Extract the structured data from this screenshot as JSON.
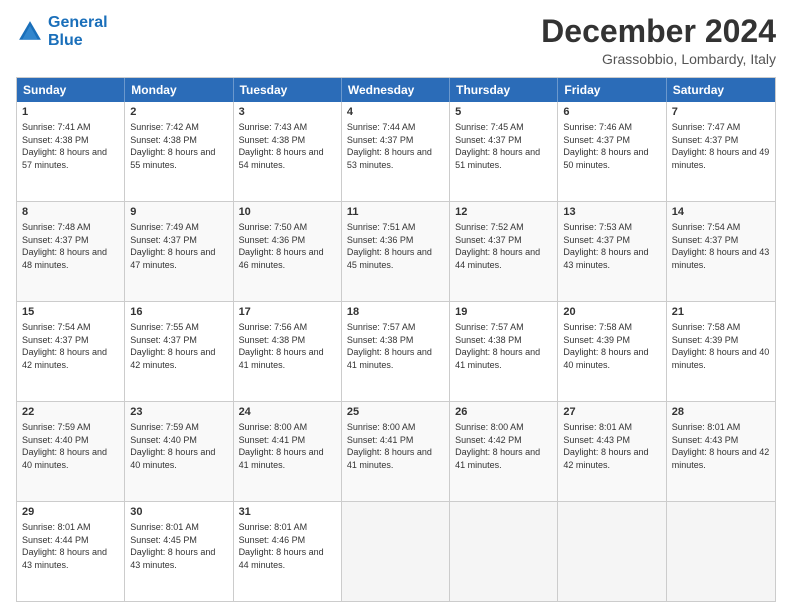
{
  "header": {
    "logo_line1": "General",
    "logo_line2": "Blue",
    "main_title": "December 2024",
    "sub_title": "Grassobbio, Lombardy, Italy"
  },
  "days_of_week": [
    "Sunday",
    "Monday",
    "Tuesday",
    "Wednesday",
    "Thursday",
    "Friday",
    "Saturday"
  ],
  "weeks": [
    [
      {
        "day": "1",
        "rise": "Sunrise: 7:41 AM",
        "set": "Sunset: 4:38 PM",
        "daylight": "Daylight: 8 hours and 57 minutes."
      },
      {
        "day": "2",
        "rise": "Sunrise: 7:42 AM",
        "set": "Sunset: 4:38 PM",
        "daylight": "Daylight: 8 hours and 55 minutes."
      },
      {
        "day": "3",
        "rise": "Sunrise: 7:43 AM",
        "set": "Sunset: 4:38 PM",
        "daylight": "Daylight: 8 hours and 54 minutes."
      },
      {
        "day": "4",
        "rise": "Sunrise: 7:44 AM",
        "set": "Sunset: 4:37 PM",
        "daylight": "Daylight: 8 hours and 53 minutes."
      },
      {
        "day": "5",
        "rise": "Sunrise: 7:45 AM",
        "set": "Sunset: 4:37 PM",
        "daylight": "Daylight: 8 hours and 51 minutes."
      },
      {
        "day": "6",
        "rise": "Sunrise: 7:46 AM",
        "set": "Sunset: 4:37 PM",
        "daylight": "Daylight: 8 hours and 50 minutes."
      },
      {
        "day": "7",
        "rise": "Sunrise: 7:47 AM",
        "set": "Sunset: 4:37 PM",
        "daylight": "Daylight: 8 hours and 49 minutes."
      }
    ],
    [
      {
        "day": "8",
        "rise": "Sunrise: 7:48 AM",
        "set": "Sunset: 4:37 PM",
        "daylight": "Daylight: 8 hours and 48 minutes."
      },
      {
        "day": "9",
        "rise": "Sunrise: 7:49 AM",
        "set": "Sunset: 4:37 PM",
        "daylight": "Daylight: 8 hours and 47 minutes."
      },
      {
        "day": "10",
        "rise": "Sunrise: 7:50 AM",
        "set": "Sunset: 4:36 PM",
        "daylight": "Daylight: 8 hours and 46 minutes."
      },
      {
        "day": "11",
        "rise": "Sunrise: 7:51 AM",
        "set": "Sunset: 4:36 PM",
        "daylight": "Daylight: 8 hours and 45 minutes."
      },
      {
        "day": "12",
        "rise": "Sunrise: 7:52 AM",
        "set": "Sunset: 4:37 PM",
        "daylight": "Daylight: 8 hours and 44 minutes."
      },
      {
        "day": "13",
        "rise": "Sunrise: 7:53 AM",
        "set": "Sunset: 4:37 PM",
        "daylight": "Daylight: 8 hours and 43 minutes."
      },
      {
        "day": "14",
        "rise": "Sunrise: 7:54 AM",
        "set": "Sunset: 4:37 PM",
        "daylight": "Daylight: 8 hours and 43 minutes."
      }
    ],
    [
      {
        "day": "15",
        "rise": "Sunrise: 7:54 AM",
        "set": "Sunset: 4:37 PM",
        "daylight": "Daylight: 8 hours and 42 minutes."
      },
      {
        "day": "16",
        "rise": "Sunrise: 7:55 AM",
        "set": "Sunset: 4:37 PM",
        "daylight": "Daylight: 8 hours and 42 minutes."
      },
      {
        "day": "17",
        "rise": "Sunrise: 7:56 AM",
        "set": "Sunset: 4:38 PM",
        "daylight": "Daylight: 8 hours and 41 minutes."
      },
      {
        "day": "18",
        "rise": "Sunrise: 7:57 AM",
        "set": "Sunset: 4:38 PM",
        "daylight": "Daylight: 8 hours and 41 minutes."
      },
      {
        "day": "19",
        "rise": "Sunrise: 7:57 AM",
        "set": "Sunset: 4:38 PM",
        "daylight": "Daylight: 8 hours and 41 minutes."
      },
      {
        "day": "20",
        "rise": "Sunrise: 7:58 AM",
        "set": "Sunset: 4:39 PM",
        "daylight": "Daylight: 8 hours and 40 minutes."
      },
      {
        "day": "21",
        "rise": "Sunrise: 7:58 AM",
        "set": "Sunset: 4:39 PM",
        "daylight": "Daylight: 8 hours and 40 minutes."
      }
    ],
    [
      {
        "day": "22",
        "rise": "Sunrise: 7:59 AM",
        "set": "Sunset: 4:40 PM",
        "daylight": "Daylight: 8 hours and 40 minutes."
      },
      {
        "day": "23",
        "rise": "Sunrise: 7:59 AM",
        "set": "Sunset: 4:40 PM",
        "daylight": "Daylight: 8 hours and 40 minutes."
      },
      {
        "day": "24",
        "rise": "Sunrise: 8:00 AM",
        "set": "Sunset: 4:41 PM",
        "daylight": "Daylight: 8 hours and 41 minutes."
      },
      {
        "day": "25",
        "rise": "Sunrise: 8:00 AM",
        "set": "Sunset: 4:41 PM",
        "daylight": "Daylight: 8 hours and 41 minutes."
      },
      {
        "day": "26",
        "rise": "Sunrise: 8:00 AM",
        "set": "Sunset: 4:42 PM",
        "daylight": "Daylight: 8 hours and 41 minutes."
      },
      {
        "day": "27",
        "rise": "Sunrise: 8:01 AM",
        "set": "Sunset: 4:43 PM",
        "daylight": "Daylight: 8 hours and 42 minutes."
      },
      {
        "day": "28",
        "rise": "Sunrise: 8:01 AM",
        "set": "Sunset: 4:43 PM",
        "daylight": "Daylight: 8 hours and 42 minutes."
      }
    ],
    [
      {
        "day": "29",
        "rise": "Sunrise: 8:01 AM",
        "set": "Sunset: 4:44 PM",
        "daylight": "Daylight: 8 hours and 43 minutes."
      },
      {
        "day": "30",
        "rise": "Sunrise: 8:01 AM",
        "set": "Sunset: 4:45 PM",
        "daylight": "Daylight: 8 hours and 43 minutes."
      },
      {
        "day": "31",
        "rise": "Sunrise: 8:01 AM",
        "set": "Sunset: 4:46 PM",
        "daylight": "Daylight: 8 hours and 44 minutes."
      },
      null,
      null,
      null,
      null
    ]
  ]
}
